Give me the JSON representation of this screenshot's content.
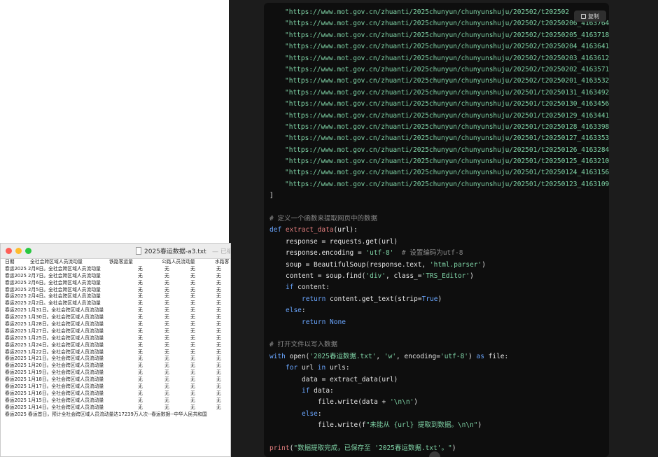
{
  "code_panel": {
    "copy_label": "复制",
    "url_lines": [
      "\"https://www.mot.gov.cn/zhuanti/2025chunyun/chunyunshuju/202502/t202502",
      "\"https://www.mot.gov.cn/zhuanti/2025chunyun/chunyunshuju/202502/t20250206_4163764",
      "\"https://www.mot.gov.cn/zhuanti/2025chunyun/chunyunshuju/202502/t20250205_4163718",
      "\"https://www.mot.gov.cn/zhuanti/2025chunyun/chunyunshuju/202502/t20250204_4163641",
      "\"https://www.mot.gov.cn/zhuanti/2025chunyun/chunyunshuju/202502/t20250203_4163612",
      "\"https://www.mot.gov.cn/zhuanti/2025chunyun/chunyunshuju/202502/t20250202_4163571",
      "\"https://www.mot.gov.cn/zhuanti/2025chunyun/chunyunshuju/202502/t20250201_4163532",
      "\"https://www.mot.gov.cn/zhuanti/2025chunyun/chunyunshuju/202501/t20250131_4163492",
      "\"https://www.mot.gov.cn/zhuanti/2025chunyun/chunyunshuju/202501/t20250130_4163456",
      "\"https://www.mot.gov.cn/zhuanti/2025chunyun/chunyunshuju/202501/t20250129_4163441",
      "\"https://www.mot.gov.cn/zhuanti/2025chunyun/chunyunshuju/202501/t20250128_4163398",
      "\"https://www.mot.gov.cn/zhuanti/2025chunyun/chunyunshuju/202501/t20250127_4163353",
      "\"https://www.mot.gov.cn/zhuanti/2025chunyun/chunyunshuju/202501/t20250126_4163284",
      "\"https://www.mot.gov.cn/zhuanti/2025chunyun/chunyunshuju/202501/t20250125_4163210",
      "\"https://www.mot.gov.cn/zhuanti/2025chunyun/chunyunshuju/202501/t20250124_4163156",
      "\"https://www.mot.gov.cn/zhuanti/2025chunyun/chunyunshuju/202501/t20250123_4163109"
    ],
    "lines": [
      {
        "indent": 0,
        "parts": [
          {
            "t": "]",
            "c": ""
          }
        ]
      },
      {
        "indent": 0,
        "parts": [
          {
            "t": "",
            "c": ""
          }
        ]
      },
      {
        "indent": 0,
        "parts": [
          {
            "t": "# 定义一个函数来提取网页中的数据",
            "c": "cm"
          }
        ]
      },
      {
        "indent": 0,
        "parts": [
          {
            "t": "def ",
            "c": "kw"
          },
          {
            "t": "extract_data",
            "c": "fn"
          },
          {
            "t": "(url):",
            "c": ""
          }
        ]
      },
      {
        "indent": 1,
        "parts": [
          {
            "t": "response = requests.get(url)",
            "c": ""
          }
        ]
      },
      {
        "indent": 1,
        "parts": [
          {
            "t": "response.encoding = ",
            "c": ""
          },
          {
            "t": "'utf-8'",
            "c": "str"
          },
          {
            "t": "  # 设置编码为utf-8",
            "c": "cm"
          }
        ]
      },
      {
        "indent": 1,
        "parts": [
          {
            "t": "soup = BeautifulSoup(response.text, ",
            "c": ""
          },
          {
            "t": "'html.parser'",
            "c": "str"
          },
          {
            "t": ")",
            "c": ""
          }
        ]
      },
      {
        "indent": 1,
        "parts": [
          {
            "t": "content = soup.find(",
            "c": ""
          },
          {
            "t": "'div'",
            "c": "str"
          },
          {
            "t": ", class_=",
            "c": ""
          },
          {
            "t": "'TRS_Editor'",
            "c": "str"
          },
          {
            "t": ")",
            "c": ""
          }
        ]
      },
      {
        "indent": 1,
        "parts": [
          {
            "t": "if ",
            "c": "kw"
          },
          {
            "t": "content:",
            "c": ""
          }
        ]
      },
      {
        "indent": 2,
        "parts": [
          {
            "t": "return ",
            "c": "kw"
          },
          {
            "t": "content.get_text(strip=",
            "c": ""
          },
          {
            "t": "True",
            "c": "bl"
          },
          {
            "t": ")",
            "c": ""
          }
        ]
      },
      {
        "indent": 1,
        "parts": [
          {
            "t": "else",
            "c": "kw"
          },
          {
            "t": ":",
            "c": ""
          }
        ]
      },
      {
        "indent": 2,
        "parts": [
          {
            "t": "return ",
            "c": "kw"
          },
          {
            "t": "None",
            "c": "bl"
          }
        ]
      },
      {
        "indent": 0,
        "parts": [
          {
            "t": "",
            "c": ""
          }
        ]
      },
      {
        "indent": 0,
        "parts": [
          {
            "t": "# 打开文件以写入数据",
            "c": "cm"
          }
        ]
      },
      {
        "indent": 0,
        "parts": [
          {
            "t": "with ",
            "c": "kw"
          },
          {
            "t": "open(",
            "c": ""
          },
          {
            "t": "'2025春运数据.txt'",
            "c": "str"
          },
          {
            "t": ", ",
            "c": ""
          },
          {
            "t": "'w'",
            "c": "str"
          },
          {
            "t": ", encoding=",
            "c": ""
          },
          {
            "t": "'utf-8'",
            "c": "str"
          },
          {
            "t": ") ",
            "c": ""
          },
          {
            "t": "as ",
            "c": "kw"
          },
          {
            "t": "file:",
            "c": ""
          }
        ]
      },
      {
        "indent": 1,
        "parts": [
          {
            "t": "for ",
            "c": "kw"
          },
          {
            "t": "url ",
            "c": ""
          },
          {
            "t": "in ",
            "c": "kw"
          },
          {
            "t": "urls:",
            "c": ""
          }
        ]
      },
      {
        "indent": 2,
        "parts": [
          {
            "t": "data = extract_data(url)",
            "c": ""
          }
        ]
      },
      {
        "indent": 2,
        "parts": [
          {
            "t": "if ",
            "c": "kw"
          },
          {
            "t": "data:",
            "c": ""
          }
        ]
      },
      {
        "indent": 3,
        "parts": [
          {
            "t": "file.write(data + ",
            "c": ""
          },
          {
            "t": "'\\n\\n'",
            "c": "str"
          },
          {
            "t": ")",
            "c": ""
          }
        ]
      },
      {
        "indent": 2,
        "parts": [
          {
            "t": "else",
            "c": "kw"
          },
          {
            "t": ":",
            "c": ""
          }
        ]
      },
      {
        "indent": 3,
        "parts": [
          {
            "t": "file.write(f",
            "c": ""
          },
          {
            "t": "\"未能从 {url} 提取到数据。\\n\\n\"",
            "c": "str"
          },
          {
            "t": ")",
            "c": ""
          }
        ]
      },
      {
        "indent": 0,
        "parts": [
          {
            "t": "",
            "c": ""
          }
        ]
      },
      {
        "indent": 0,
        "parts": [
          {
            "t": "print",
            "c": "fn"
          },
          {
            "t": "(",
            "c": ""
          },
          {
            "t": "\"数据提取完成，已保存至 '2025春运数据.txt'。\"",
            "c": "str"
          },
          {
            "t": ")",
            "c": ""
          }
        ]
      }
    ]
  },
  "txt_window": {
    "title": "2025春运数据-a3.txt",
    "status": "— 已编",
    "headers": [
      "日期",
      "全社会跨区域人员流动量",
      "铁路客运量",
      "公路人员流动量",
      "水路客"
    ],
    "rows": [
      [
        "春运2025 2月8日。全社会跨区域人员流动量",
        "无",
        "无",
        "无",
        "无"
      ],
      [
        "春运2025 2月7日。全社会跨区域人员流动量",
        "无",
        "无",
        "无",
        "无"
      ],
      [
        "春运2025 2月6日。全社会跨区域人员流动量",
        "无",
        "无",
        "无",
        "无"
      ],
      [
        "春运2025 2月5日。全社会跨区域人员流动量",
        "无",
        "无",
        "无",
        "无"
      ],
      [
        "春运2025 2月4日。全社会跨区域人员流动量",
        "无",
        "无",
        "无",
        "无"
      ],
      [
        "春运2025 2月2日。全社会跨区域人员流动量",
        "无",
        "无",
        "无",
        "无"
      ],
      [
        "春运2025 1月31日。全社会跨区域人员流动量",
        "无",
        "无",
        "无",
        "无"
      ],
      [
        "春运2025 1月30日。全社会跨区域人员流动量",
        "无",
        "无",
        "无",
        "无"
      ],
      [
        "春运2025 1月28日。全社会跨区域人员流动量",
        "无",
        "无",
        "无",
        "无"
      ],
      [
        "春运2025 1月27日。全社会跨区域人员流动量",
        "无",
        "无",
        "无",
        "无"
      ],
      [
        "春运2025 1月25日。全社会跨区域人员流动量",
        "无",
        "无",
        "无",
        "无"
      ],
      [
        "春运2025 1月24日。全社会跨区域人员流动量",
        "无",
        "无",
        "无",
        "无"
      ],
      [
        "春运2025 1月22日。全社会跨区域人员流动量",
        "无",
        "无",
        "无",
        "无"
      ],
      [
        "春运2025 1月21日。全社会跨区域人员流动量",
        "无",
        "无",
        "无",
        "无"
      ],
      [
        "春运2025 1月20日。全社会跨区域人员流动量",
        "无",
        "无",
        "无",
        "无"
      ],
      [
        "春运2025 1月19日。全社会跨区域人员流动量",
        "无",
        "无",
        "无",
        "无"
      ],
      [
        "春运2025 1月18日。全社会跨区域人员流动量",
        "无",
        "无",
        "无",
        "无"
      ],
      [
        "春运2025 1月17日。全社会跨区域人员流动量",
        "无",
        "无",
        "无",
        "无"
      ],
      [
        "春运2025 1月16日。全社会跨区域人员流动量",
        "无",
        "无",
        "无",
        "无"
      ],
      [
        "春运2025 1月15日。全社会跨区域人员流动量",
        "无",
        "无",
        "无",
        "无"
      ],
      [
        "春运2025 1月14日。全社会跨区域人员流动量",
        "无",
        "无",
        "无",
        "无"
      ]
    ],
    "footer_line": "春运2025 春运首日，预计全社会跨区域人员流动量达17239万人次--春运数据--中华人民共和国"
  },
  "colors": {
    "code_bg": "#0e0e0e",
    "string": "#7fd3a6",
    "keyword": "#6aa6ff",
    "function": "#e07c7c",
    "comment": "#8a8a8a"
  }
}
